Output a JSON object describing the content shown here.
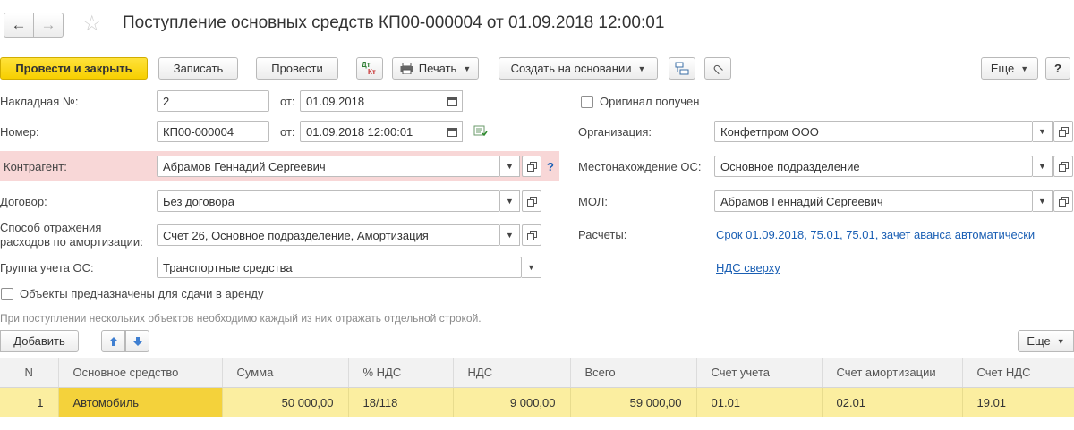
{
  "titlebar": {
    "title": "Поступление основных средств КП00-000004 от 01.09.2018 12:00:01"
  },
  "toolbar": {
    "post_close": "Провести и закрыть",
    "save": "Записать",
    "post": "Провести",
    "print": "Печать",
    "create_based": "Создать на основании",
    "more": "Еще",
    "help": "?",
    "dtkt_top": "Дт",
    "dtkt_bottom": "Кт"
  },
  "form": {
    "invoice_label": "Накладная №:",
    "invoice_value": "2",
    "from_label": "от:",
    "invoice_date": "01.09.2018",
    "number_label": "Номер:",
    "number_value": "КП00-000004",
    "number_date": "01.09.2018 12:00:01",
    "counterparty_label": "Контрагент:",
    "counterparty_value": "Абрамов Геннадий Сергеевич",
    "counterparty_help": "?",
    "contract_label": "Договор:",
    "contract_value": "Без договора",
    "depr_label_1": "Способ отражения",
    "depr_label_2": "расходов по амортизации:",
    "depr_value": "Счет 26, Основное подразделение, Амортизация",
    "group_label": "Группа учета ОС:",
    "group_value": "Транспортные средства",
    "rent_checkbox": "Объекты предназначены для сдачи в аренду",
    "original_checkbox": "Оригинал получен",
    "org_label": "Организация:",
    "org_value": "Конфетпром ООО",
    "location_label": "Местонахождение ОС:",
    "location_value": "Основное подразделение",
    "mol_label": "МОЛ:",
    "mol_value": "Абрамов Геннадий Сергеевич",
    "settlements_label": "Расчеты:",
    "settlements_link": "Срок 01.09.2018, 75.01, 75.01, зачет аванса автоматически",
    "vat_link": "НДС сверху",
    "hint": "При поступлении нескольких объектов необходимо каждый из них отражать отдельной строкой."
  },
  "table_toolbar": {
    "add": "Добавить",
    "more": "Еще"
  },
  "table": {
    "columns": [
      "N",
      "Основное средство",
      "Сумма",
      "% НДС",
      "НДС",
      "Всего",
      "Счет учета",
      "Счет амортизации",
      "Счет НДС"
    ],
    "rows": [
      [
        "1",
        "Автомобиль",
        "50 000,00",
        "18/118",
        "9 000,00",
        "59 000,00",
        "01.01",
        "02.01",
        "19.01"
      ]
    ]
  },
  "colors": {
    "primary_button": "#f7cf00",
    "highlight_row": "#fbeea0",
    "selected_cell": "#f4d23b",
    "required_field_bg": "#f8d7d7",
    "link": "#1a5fb4"
  }
}
